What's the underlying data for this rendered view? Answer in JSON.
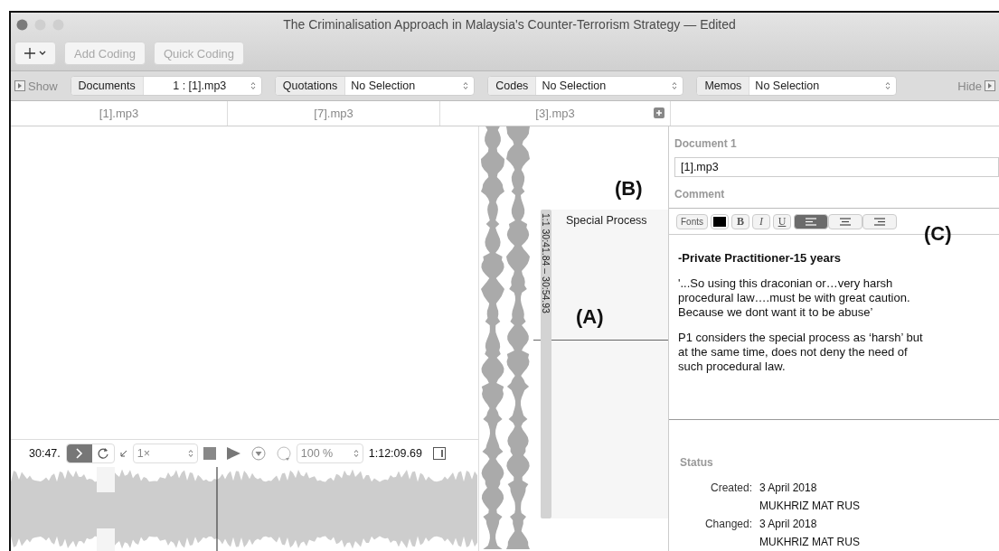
{
  "window": {
    "title": "The Criminalisation Approach in Malaysia's Counter-Terrorism Strategy — Edited"
  },
  "toolbar": {
    "buttons": [
      {
        "label": "Add Coding",
        "disabled": true
      },
      {
        "label": "Quick Coding",
        "disabled": true
      }
    ]
  },
  "navigator": {
    "show_label": "Show",
    "hide_label": "Hide",
    "selectors": [
      {
        "label": "Documents",
        "value": "1 : [1].mp3"
      },
      {
        "label": "Quotations",
        "value": "No Selection"
      },
      {
        "label": "Codes",
        "value": "No Selection"
      },
      {
        "label": "Memos",
        "value": "No Selection"
      }
    ]
  },
  "tabs": [
    {
      "label": "[1].mp3"
    },
    {
      "label": "[7].mp3"
    },
    {
      "label": "[3].mp3"
    }
  ],
  "player": {
    "current_time": "30:47.",
    "speed": "1×",
    "zoom": "100 %",
    "duration": "1:12:09.69"
  },
  "margin": {
    "range": "1:1 30:41.84 – 30:54.93",
    "code": "Special Process"
  },
  "callouts": [
    {
      "label": "(A)"
    },
    {
      "label": "(B)"
    },
    {
      "label": "(C)"
    }
  ],
  "inspector": {
    "document_heading": "Document 1",
    "document_name": "[1].mp3",
    "comment_heading": "Comment",
    "format_bar": {
      "fonts": "Fonts",
      "bold": "B",
      "italic": "I",
      "underline": "U",
      "alignments": [
        {
          "kind": "left",
          "selected": true
        },
        {
          "kind": "center",
          "selected": false
        },
        {
          "kind": "right",
          "selected": false
        }
      ]
    },
    "comment": {
      "title": "-Private Practitioner-15 years",
      "paragraphs": [
        "'...So using this draconian or…very harsh procedural law….must be with great caution. Because we dont want it to be abuse’",
        "P1 considers the special process as ‘harsh’ but at the same time, does not deny the need of such procedural law."
      ]
    },
    "status_heading": "Status",
    "status": [
      {
        "label": "Created:",
        "date": "3 April 2018",
        "author": "MUKHRIZ MAT RUS"
      },
      {
        "label": "Changed:",
        "date": "3 April 2018",
        "author": "MUKHRIZ MAT RUS"
      }
    ]
  }
}
